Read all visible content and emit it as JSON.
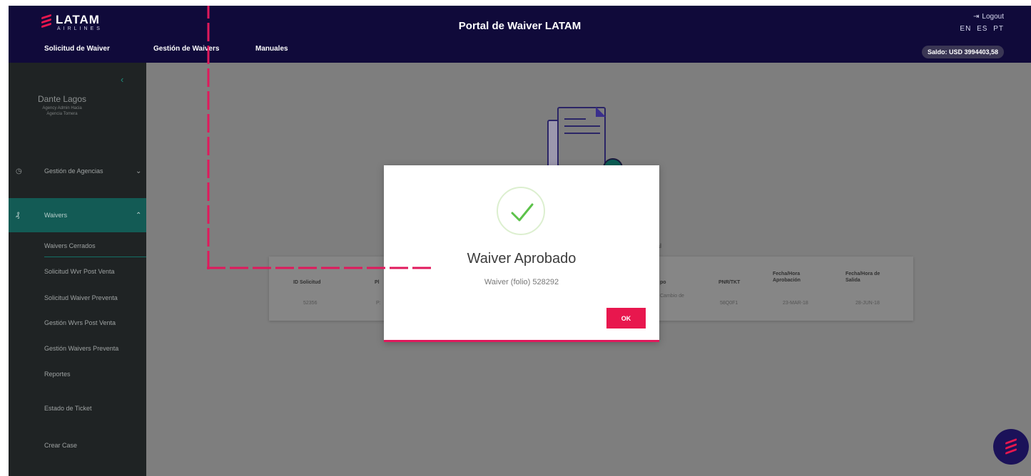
{
  "header": {
    "logo_text": "LATAM",
    "logo_sub": "AIRLINES",
    "title": "Portal de Waiver LATAM",
    "nav": [
      "Solicitud de Waiver",
      "Gestión de Waivers",
      "Manuales"
    ],
    "logout": "Logout",
    "langs": [
      "EN",
      "ES",
      "PT"
    ],
    "balance": "Saldo: USD 3994403,58"
  },
  "sidebar": {
    "user_name": "Dante Lagos",
    "user_role_1": "Agency Admin Hacia",
    "user_role_2": "Agencia Tomera",
    "menu": [
      {
        "label": "Gestión de Agencias",
        "icon": "clock-icon"
      },
      {
        "label": "Waivers",
        "icon": "waiver-icon"
      }
    ],
    "submenu": [
      "Waivers Cerrados",
      "Solicitud Wvr Post Venta",
      "Solicitud Waiver Preventa",
      "Gestión Wvrs Post Venta",
      "Gestión Waivers Preventa",
      "Reportes"
    ],
    "bottom": [
      "Estado de Ticket",
      "Crear Case"
    ]
  },
  "table": {
    "caption": "al",
    "headers": [
      "ID Solicitud",
      "Pl",
      "po",
      "PNR/TKT",
      "Fecha/Hora Aprobación",
      "Fecha/Hora de Salida"
    ],
    "row": [
      "52356",
      "P:",
      "Cambio de",
      "58Q0F1",
      "23-MAR-18",
      "28-JUN-18"
    ]
  },
  "modal": {
    "title": "Waiver Aprobado",
    "folio": "Waiver (folio) 528292",
    "ok": "OK"
  },
  "colors": {
    "brand_navy": "#100a3a",
    "brand_red": "#e8174e",
    "accent_teal": "#135b55",
    "success": "#5cc24a"
  }
}
